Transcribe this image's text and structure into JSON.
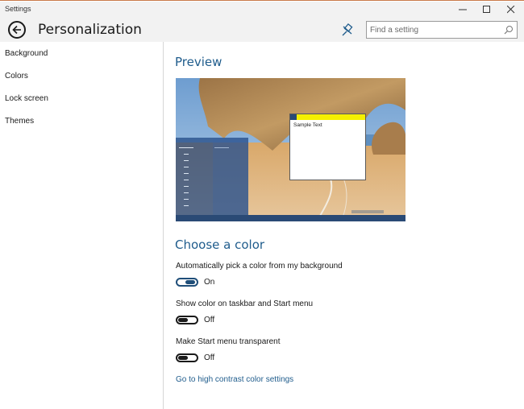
{
  "window": {
    "title": "Settings"
  },
  "header": {
    "page_title": "Personalization",
    "search_placeholder": "Find a setting"
  },
  "sidebar": {
    "items": [
      {
        "label": "Background"
      },
      {
        "label": "Colors"
      },
      {
        "label": "Lock screen"
      },
      {
        "label": "Themes"
      }
    ]
  },
  "main": {
    "preview_title": "Preview",
    "sample_text": "Sample Text",
    "color_title": "Choose a color",
    "settings": [
      {
        "label": "Automatically pick a color from my background",
        "state": "On"
      },
      {
        "label": "Show color on taskbar and Start menu",
        "state": "Off"
      },
      {
        "label": "Make Start menu transparent",
        "state": "Off"
      }
    ],
    "contrast_link": "Go to high contrast color settings"
  },
  "colors": {
    "accent": "#1f5c8c",
    "sample_titlebar": "#f5f000",
    "taskbar": "#2a4a75"
  }
}
